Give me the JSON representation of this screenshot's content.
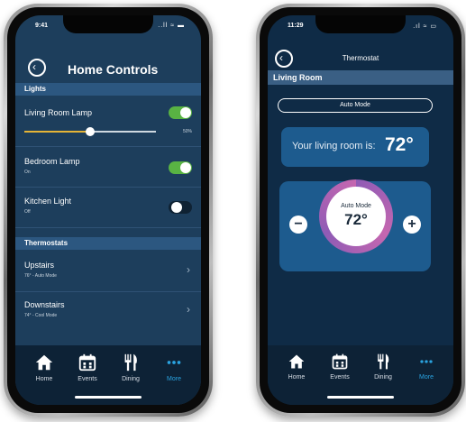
{
  "left_phone": {
    "status": {
      "time": "9:41",
      "icons": "..ll ≈ ▬"
    },
    "header": {
      "title": "Home Controls"
    },
    "lights": {
      "section_label": "Lights",
      "items": [
        {
          "label": "Living Room Lamp",
          "brightness": "50%",
          "brightness_value": 0.5,
          "on": true
        },
        {
          "label": "Bedroom Lamp",
          "sub": "On",
          "on": true
        },
        {
          "label": "Kitchen Light",
          "sub": "Off",
          "on": false
        }
      ]
    },
    "thermostats": {
      "section_label": "Thermostats",
      "items": [
        {
          "label": "Upstairs",
          "sub": "76° - Auto Mode"
        },
        {
          "label": "Downstairs",
          "sub": "74° - Cool Mode"
        }
      ]
    },
    "tabs": [
      {
        "label": "Home",
        "icon": "home-icon",
        "active": false
      },
      {
        "label": "Events",
        "icon": "calendar-icon",
        "active": false
      },
      {
        "label": "Dining",
        "icon": "fork-knife-icon",
        "active": false
      },
      {
        "label": "More",
        "icon": "more-icon",
        "active": true
      }
    ]
  },
  "right_phone": {
    "status": {
      "time": "11:29",
      "icons": ".ıl ≈ ▭"
    },
    "header": {
      "title": "Thermostat"
    },
    "room": "Living Room",
    "mode_button": "Auto Mode",
    "temp_card": {
      "text": "Your living room is:",
      "value": "72°"
    },
    "dial": {
      "mode": "Auto Mode",
      "value": "72°",
      "minus": "−",
      "plus": "+"
    },
    "tabs": [
      {
        "label": "Home",
        "icon": "home-icon",
        "active": false
      },
      {
        "label": "Events",
        "icon": "calendar-icon",
        "active": false
      },
      {
        "label": "Dining",
        "icon": "fork-knife-icon",
        "active": false
      },
      {
        "label": "More",
        "icon": "more-icon",
        "active": true
      }
    ]
  },
  "colors": {
    "accent": "#2aa3e0",
    "toggle_on": "#59b343",
    "section_header": "#2c5780",
    "card": "#1d5b8e",
    "dial_ring": "#c567b0"
  }
}
